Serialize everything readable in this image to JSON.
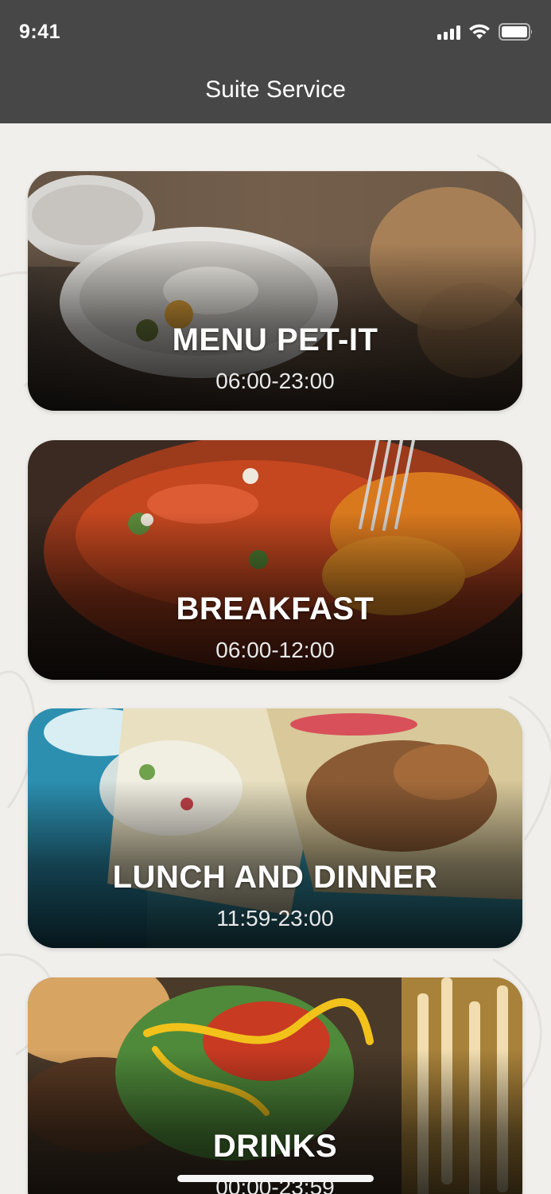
{
  "status_bar": {
    "time": "9:41"
  },
  "header": {
    "title": "Suite Service"
  },
  "menu_cards": [
    {
      "title": "MENU PET-IT",
      "hours": "06:00-23:00"
    },
    {
      "title": "BREAKFAST",
      "hours": "06:00-12:00"
    },
    {
      "title": "LUNCH AND DINNER",
      "hours": "11:59-23:00"
    },
    {
      "title": "DRINKS",
      "hours": "00:00-23:59"
    }
  ],
  "colors": {
    "header_bg": "#474747",
    "page_bg": "#f1efeb",
    "card_text": "#ffffff"
  }
}
